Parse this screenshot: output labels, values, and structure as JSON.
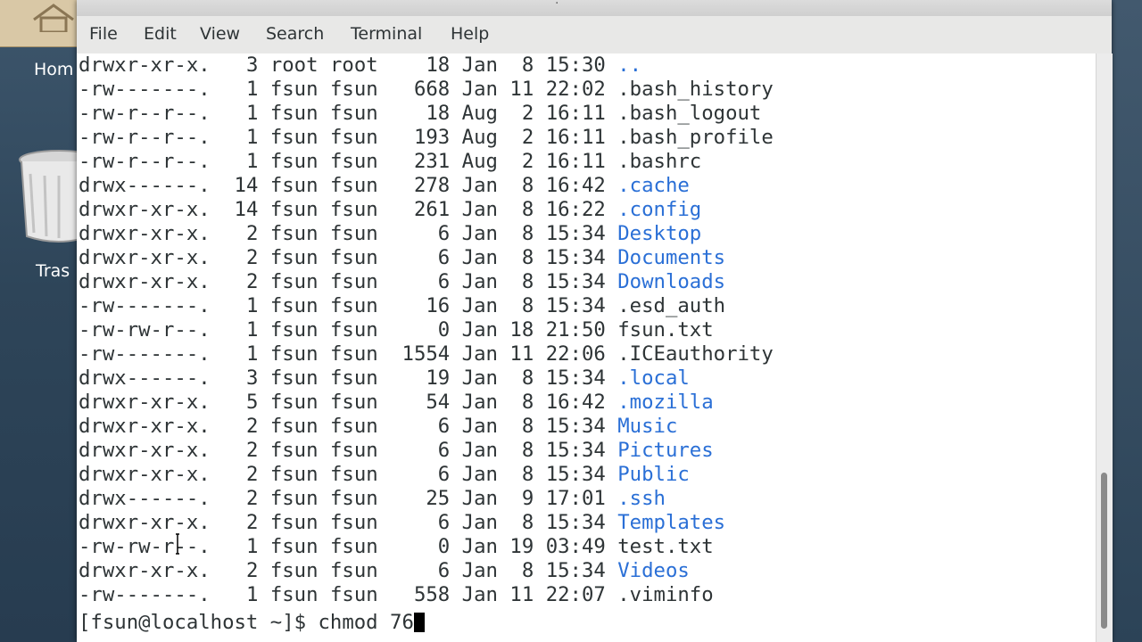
{
  "desktop": {
    "home_label": "Hom",
    "trash_label": "Tras"
  },
  "window": {
    "title_partial": "·"
  },
  "menu": {
    "items": [
      "File",
      "Edit",
      "View",
      "Search",
      "Terminal",
      "Help"
    ]
  },
  "listing": [
    {
      "perms": "drwxr-xr-x.",
      "links": "3",
      "owner": "root",
      "group": "root",
      "size": "18",
      "month": "Jan",
      "day": "8",
      "time": "15:30",
      "name": "..",
      "dir": true
    },
    {
      "perms": "-rw-------.",
      "links": "1",
      "owner": "fsun",
      "group": "fsun",
      "size": "668",
      "month": "Jan",
      "day": "11",
      "time": "22:02",
      "name": ".bash_history",
      "dir": false
    },
    {
      "perms": "-rw-r--r--.",
      "links": "1",
      "owner": "fsun",
      "group": "fsun",
      "size": "18",
      "month": "Aug",
      "day": "2",
      "time": "16:11",
      "name": ".bash_logout",
      "dir": false
    },
    {
      "perms": "-rw-r--r--.",
      "links": "1",
      "owner": "fsun",
      "group": "fsun",
      "size": "193",
      "month": "Aug",
      "day": "2",
      "time": "16:11",
      "name": ".bash_profile",
      "dir": false
    },
    {
      "perms": "-rw-r--r--.",
      "links": "1",
      "owner": "fsun",
      "group": "fsun",
      "size": "231",
      "month": "Aug",
      "day": "2",
      "time": "16:11",
      "name": ".bashrc",
      "dir": false
    },
    {
      "perms": "drwx------.",
      "links": "14",
      "owner": "fsun",
      "group": "fsun",
      "size": "278",
      "month": "Jan",
      "day": "8",
      "time": "16:42",
      "name": ".cache",
      "dir": true
    },
    {
      "perms": "drwxr-xr-x.",
      "links": "14",
      "owner": "fsun",
      "group": "fsun",
      "size": "261",
      "month": "Jan",
      "day": "8",
      "time": "16:22",
      "name": ".config",
      "dir": true
    },
    {
      "perms": "drwxr-xr-x.",
      "links": "2",
      "owner": "fsun",
      "group": "fsun",
      "size": "6",
      "month": "Jan",
      "day": "8",
      "time": "15:34",
      "name": "Desktop",
      "dir": true
    },
    {
      "perms": "drwxr-xr-x.",
      "links": "2",
      "owner": "fsun",
      "group": "fsun",
      "size": "6",
      "month": "Jan",
      "day": "8",
      "time": "15:34",
      "name": "Documents",
      "dir": true
    },
    {
      "perms": "drwxr-xr-x.",
      "links": "2",
      "owner": "fsun",
      "group": "fsun",
      "size": "6",
      "month": "Jan",
      "day": "8",
      "time": "15:34",
      "name": "Downloads",
      "dir": true
    },
    {
      "perms": "-rw-------.",
      "links": "1",
      "owner": "fsun",
      "group": "fsun",
      "size": "16",
      "month": "Jan",
      "day": "8",
      "time": "15:34",
      "name": ".esd_auth",
      "dir": false
    },
    {
      "perms": "-rw-rw-r--.",
      "links": "1",
      "owner": "fsun",
      "group": "fsun",
      "size": "0",
      "month": "Jan",
      "day": "18",
      "time": "21:50",
      "name": "fsun.txt",
      "dir": false
    },
    {
      "perms": "-rw-------.",
      "links": "1",
      "owner": "fsun",
      "group": "fsun",
      "size": "1554",
      "month": "Jan",
      "day": "11",
      "time": "22:06",
      "name": ".ICEauthority",
      "dir": false
    },
    {
      "perms": "drwx------.",
      "links": "3",
      "owner": "fsun",
      "group": "fsun",
      "size": "19",
      "month": "Jan",
      "day": "8",
      "time": "15:34",
      "name": ".local",
      "dir": true
    },
    {
      "perms": "drwxr-xr-x.",
      "links": "5",
      "owner": "fsun",
      "group": "fsun",
      "size": "54",
      "month": "Jan",
      "day": "8",
      "time": "16:42",
      "name": ".mozilla",
      "dir": true
    },
    {
      "perms": "drwxr-xr-x.",
      "links": "2",
      "owner": "fsun",
      "group": "fsun",
      "size": "6",
      "month": "Jan",
      "day": "8",
      "time": "15:34",
      "name": "Music",
      "dir": true
    },
    {
      "perms": "drwxr-xr-x.",
      "links": "2",
      "owner": "fsun",
      "group": "fsun",
      "size": "6",
      "month": "Jan",
      "day": "8",
      "time": "15:34",
      "name": "Pictures",
      "dir": true
    },
    {
      "perms": "drwxr-xr-x.",
      "links": "2",
      "owner": "fsun",
      "group": "fsun",
      "size": "6",
      "month": "Jan",
      "day": "8",
      "time": "15:34",
      "name": "Public",
      "dir": true
    },
    {
      "perms": "drwx------.",
      "links": "2",
      "owner": "fsun",
      "group": "fsun",
      "size": "25",
      "month": "Jan",
      "day": "9",
      "time": "17:01",
      "name": ".ssh",
      "dir": true
    },
    {
      "perms": "drwxr-xr-x.",
      "links": "2",
      "owner": "fsun",
      "group": "fsun",
      "size": "6",
      "month": "Jan",
      "day": "8",
      "time": "15:34",
      "name": "Templates",
      "dir": true
    },
    {
      "perms": "-rw-rw-r--.",
      "links": "1",
      "owner": "fsun",
      "group": "fsun",
      "size": "0",
      "month": "Jan",
      "day": "19",
      "time": "03:49",
      "name": "test.txt",
      "dir": false
    },
    {
      "perms": "drwxr-xr-x.",
      "links": "2",
      "owner": "fsun",
      "group": "fsun",
      "size": "6",
      "month": "Jan",
      "day": "8",
      "time": "15:34",
      "name": "Videos",
      "dir": true
    },
    {
      "perms": "-rw-------.",
      "links": "1",
      "owner": "fsun",
      "group": "fsun",
      "size": "558",
      "month": "Jan",
      "day": "11",
      "time": "22:07",
      "name": ".viminfo",
      "dir": false
    }
  ],
  "prompt": {
    "text": "[fsun@localhost ~]$ ",
    "command": "chmod 76"
  },
  "colors": {
    "directory": "#2a6fd6",
    "text": "#2e3436",
    "background": "#ffffff"
  }
}
